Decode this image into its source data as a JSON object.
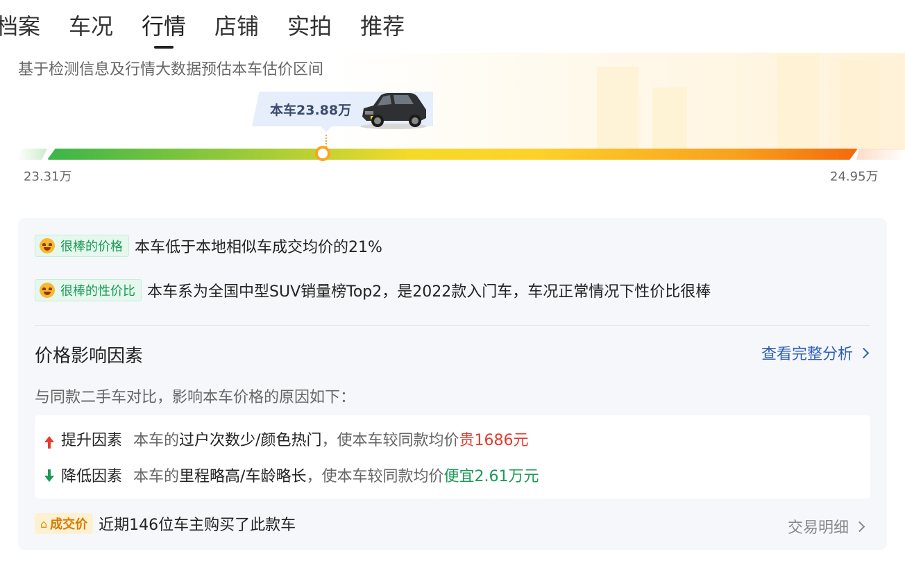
{
  "tabs": [
    {
      "label": "档案"
    },
    {
      "label": "车况"
    },
    {
      "label": "行情"
    },
    {
      "label": "店铺"
    },
    {
      "label": "实拍"
    },
    {
      "label": "推荐"
    }
  ],
  "active_tab_index": 2,
  "estimate": {
    "subtitle": "基于检测信息及行情大数据预估本车估价区间",
    "this_car_price": "本车23.88万",
    "range_min": "23.31万",
    "range_max": "24.95万",
    "this_car_position_fraction": 0.34
  },
  "highlights": [
    {
      "tag": "很棒的价格",
      "desc": "本车低于本地相似车成交均价的21%"
    },
    {
      "tag": "很棒的性价比",
      "desc": "本车系为全国中型SUV销量榜Top2，是2022款入门车，车况正常情况下性价比很棒"
    }
  ],
  "factors": {
    "title": "价格影响因素",
    "link": "查看完整分析",
    "compare_text": "与同款二手车对比，影响本车价格的原因如下：",
    "up": {
      "name": "提升因素",
      "pre": "本车的",
      "reasons": "过户次数少/颜色热门",
      "mid": "，使本车较同款均价",
      "effect": "贵1686元"
    },
    "down": {
      "name": "降低因素",
      "pre": "本车的",
      "reasons": "里程略高/车龄略长",
      "mid": "，使本车较同款均价",
      "effect": "便宜2.61万元"
    }
  },
  "deal": {
    "badge": "成交价",
    "text": "近期146位车主购买了此款车",
    "link": "交易明细"
  },
  "colors": {
    "green": "#1a9a55",
    "red": "#e43b2e",
    "link_blue": "#2f5fb3",
    "marker_orange": "#f6a623"
  }
}
